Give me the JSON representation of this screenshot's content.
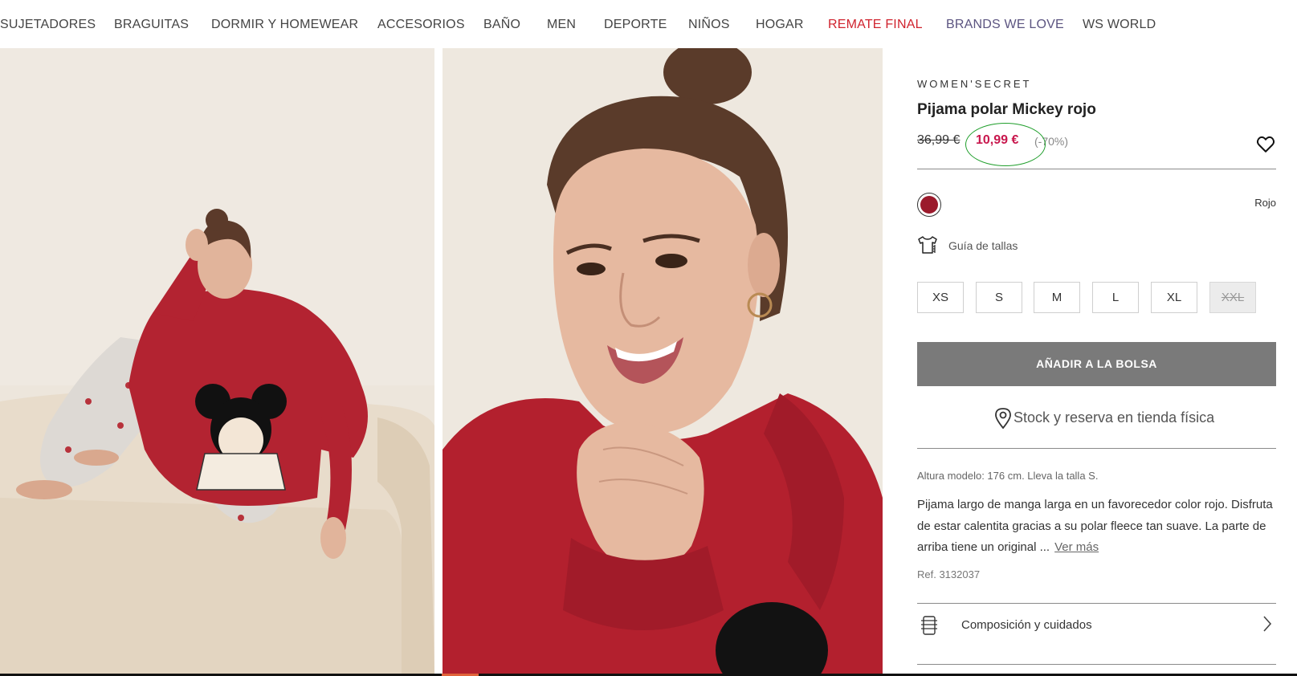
{
  "nav": {
    "items": [
      {
        "label": "SUJETADORES"
      },
      {
        "label": "BRAGUITAS"
      },
      {
        "label": "DORMIR Y HOMEWEAR"
      },
      {
        "label": "ACCESORIOS"
      },
      {
        "label": "BAÑO"
      },
      {
        "label": "MEN"
      },
      {
        "label": "DEPORTE"
      },
      {
        "label": "NIÑOS"
      },
      {
        "label": "HOGAR"
      },
      {
        "label": "REMATE FINAL",
        "color": "#d0232e"
      },
      {
        "label": "BRANDS WE LOVE",
        "color": "#5b5480"
      },
      {
        "label": "WS WORLD"
      }
    ]
  },
  "gallery": {
    "images": [
      {
        "icon": "photo-model-sofa"
      },
      {
        "icon": "photo-model-closeup"
      }
    ]
  },
  "product": {
    "brand": "WOMEN'SECRET",
    "name": "Pijama polar Mickey rojo",
    "old_price": "36,99 €",
    "price": "10,99 €",
    "discount": "(-70%)",
    "price_color": "#c8174d",
    "color_name": "Rojo",
    "color_hex": "#9b1a2c",
    "size_guide": "Guía de tallas",
    "sizes": [
      {
        "label": "XS",
        "available": true
      },
      {
        "label": "S",
        "available": true
      },
      {
        "label": "M",
        "available": true
      },
      {
        "label": "L",
        "available": true
      },
      {
        "label": "XL",
        "available": true
      },
      {
        "label": "XXL",
        "available": false
      }
    ],
    "add_to_bag": "AÑADIR A LA BOLSA",
    "stock": "Stock y reserva en tienda física",
    "model_info": "Altura modelo: 176 cm.  Lleva la talla S.",
    "description": "Pijama largo de manga larga en un favorecedor color rojo. Disfruta de estar calentita gracias a su polar fleece tan suave. La parte de arriba tiene un original ...",
    "read_more": "Ver más",
    "ref": "Ref. 3132037",
    "composition": "Composición y cuidados"
  }
}
